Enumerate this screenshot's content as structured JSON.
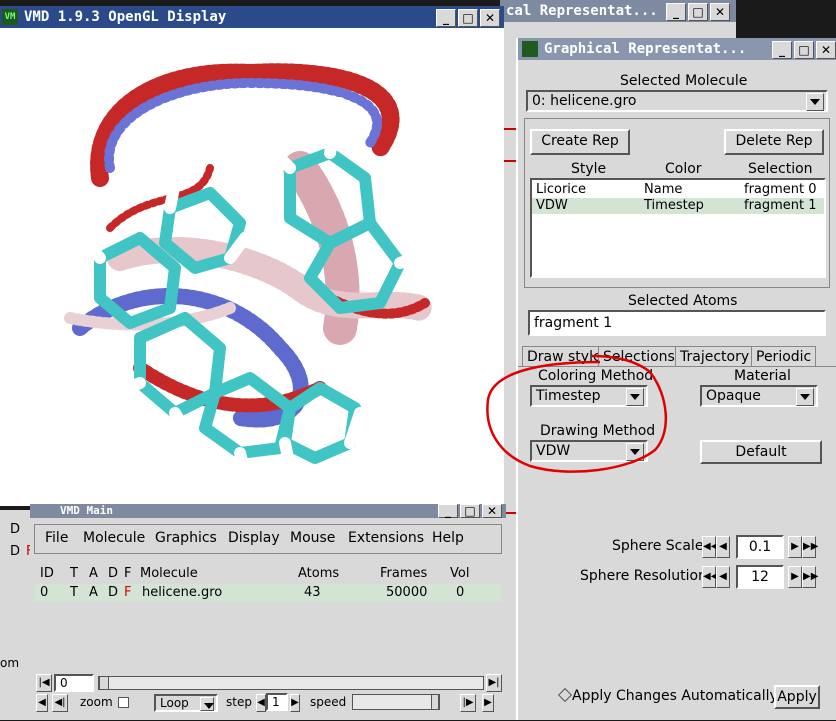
{
  "display_window": {
    "title": "VMD 1.9.3 OpenGL Display",
    "icon": "vmd-icon"
  },
  "bg_window": {
    "title": "cal Representat..."
  },
  "graphics_window": {
    "title": "Graphical Representat...",
    "selected_molecule_label": "Selected Molecule",
    "selected_molecule_value": "0: helicene.gro",
    "create_rep": "Create Rep",
    "delete_rep": "Delete Rep",
    "columns": [
      "Style",
      "Color",
      "Selection"
    ],
    "reps": [
      {
        "style": "Licorice",
        "color": "Name",
        "selection": "fragment 0"
      },
      {
        "style": "VDW",
        "color": "Timestep",
        "selection": "fragment 1"
      }
    ],
    "selected_atoms_label": "Selected Atoms",
    "selected_atoms_value": "fragment 1",
    "tabs": [
      "Draw style",
      "Selections",
      "Trajectory",
      "Periodic"
    ],
    "coloring_method_label": "Coloring Method",
    "coloring_method_value": "Timestep",
    "material_label": "Material",
    "material_value": "Opaque",
    "drawing_method_label": "Drawing Method",
    "drawing_method_value": "VDW",
    "default_button": "Default",
    "sphere_scale_label": "Sphere Scale",
    "sphere_scale_value": "0.1",
    "sphere_resolution_label": "Sphere Resolution",
    "sphere_resolution_value": "12",
    "apply_auto_label": "Apply Changes Automatically",
    "apply_button": "Apply"
  },
  "main_window": {
    "title": "VMD Main",
    "menu": [
      "File",
      "Molecule",
      "Graphics",
      "Display",
      "Mouse",
      "Extensions",
      "Help"
    ],
    "columns": [
      "ID",
      "T",
      "A",
      "D",
      "F",
      "Molecule",
      "Atoms",
      "Frames",
      "Vol"
    ],
    "molecule_row": {
      "id": "0",
      "t": "T",
      "a": "A",
      "d": "D",
      "f": "F",
      "name": "helicene.gro",
      "atoms": "43",
      "frames": "50000",
      "vol": "0"
    },
    "frame_value": "0",
    "zoom_label": "zoom",
    "loop_value": "Loop",
    "step_label": "step",
    "step_value": "1",
    "speed_label": "speed"
  },
  "left_strip": {
    "d1": "D",
    "d2": "D",
    "f": "F",
    "zoom": "om"
  },
  "colors": {
    "annotation": "#e00000",
    "selected_row": "#d4e4d4",
    "title_active": "#2a4a8a"
  }
}
